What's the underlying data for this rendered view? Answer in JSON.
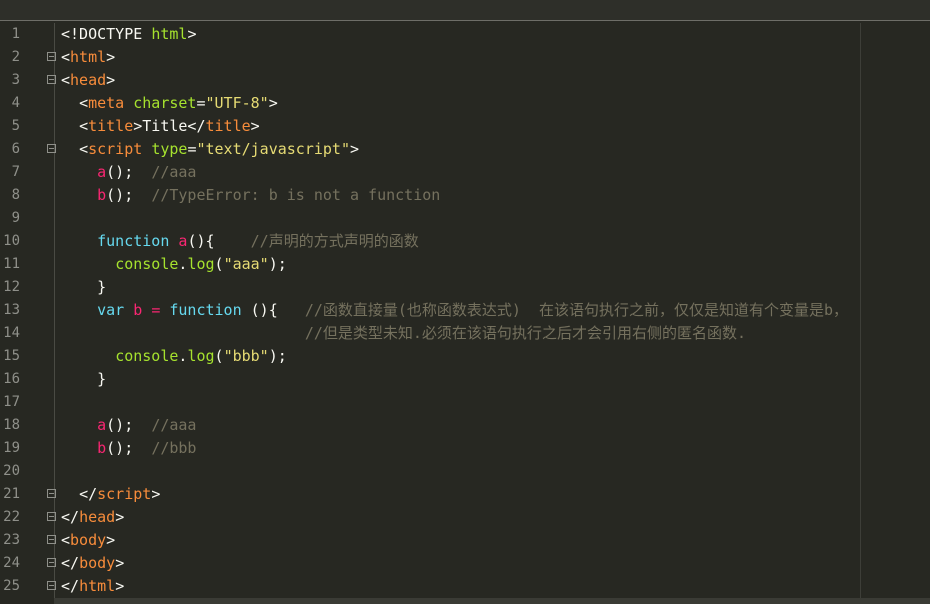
{
  "editor": {
    "lines": [
      {
        "n": "1",
        "fold": false,
        "tokens": [
          [
            "t-p",
            "<!DOCTYPE "
          ],
          [
            "t-tagname",
            "html"
          ],
          [
            "t-p",
            ">"
          ]
        ]
      },
      {
        "n": "2",
        "fold": true,
        "tokens": [
          [
            "t-p",
            "<"
          ],
          [
            "tagcolor",
            "html"
          ],
          [
            "t-p",
            ">"
          ]
        ]
      },
      {
        "n": "3",
        "fold": true,
        "tokens": [
          [
            "t-p",
            "<"
          ],
          [
            "tagcolor",
            "head"
          ],
          [
            "t-p",
            ">"
          ]
        ]
      },
      {
        "n": "4",
        "fold": false,
        "tokens": [
          [
            "ws",
            "  "
          ],
          [
            "t-p",
            "<"
          ],
          [
            "tagcolor",
            "meta "
          ],
          [
            "t-attr",
            "charset"
          ],
          [
            "t-p",
            "="
          ],
          [
            "t-str",
            "\"UTF-8\""
          ],
          [
            "t-p",
            ">"
          ]
        ]
      },
      {
        "n": "5",
        "fold": false,
        "tokens": [
          [
            "ws",
            "  "
          ],
          [
            "t-p",
            "<"
          ],
          [
            "tagcolor",
            "title"
          ],
          [
            "t-p",
            ">Title</"
          ],
          [
            "tagcolor",
            "title"
          ],
          [
            "t-p",
            ">"
          ]
        ]
      },
      {
        "n": "6",
        "fold": true,
        "tokens": [
          [
            "ws",
            "  "
          ],
          [
            "t-p",
            "<"
          ],
          [
            "tagcolor",
            "script "
          ],
          [
            "t-attr",
            "type"
          ],
          [
            "t-p",
            "="
          ],
          [
            "t-str",
            "\"text/javascript\""
          ],
          [
            "t-p",
            ">"
          ]
        ]
      },
      {
        "n": "7",
        "fold": false,
        "tokens": [
          [
            "ws",
            "    "
          ],
          [
            "t-fn",
            "a"
          ],
          [
            "t-p",
            "();"
          ],
          [
            "ws",
            "  "
          ],
          [
            "t-cm",
            "//aaa"
          ]
        ]
      },
      {
        "n": "8",
        "fold": false,
        "tokens": [
          [
            "ws",
            "    "
          ],
          [
            "t-fn",
            "b"
          ],
          [
            "t-p",
            "();"
          ],
          [
            "ws",
            "  "
          ],
          [
            "t-cm",
            "//TypeError: b is not a function"
          ]
        ]
      },
      {
        "n": "9",
        "fold": false,
        "tokens": []
      },
      {
        "n": "10",
        "fold": false,
        "tokens": [
          [
            "ws",
            "    "
          ],
          [
            "t-kw",
            "function "
          ],
          [
            "t-fn",
            "a"
          ],
          [
            "t-p",
            "(){"
          ],
          [
            "ws",
            "    "
          ],
          [
            "t-cm",
            "//声明的方式声明的函数"
          ]
        ]
      },
      {
        "n": "11",
        "fold": false,
        "tokens": [
          [
            "ws",
            "      "
          ],
          [
            "t-call",
            "console"
          ],
          [
            "t-p",
            "."
          ],
          [
            "t-call",
            "log"
          ],
          [
            "t-p",
            "("
          ],
          [
            "t-str",
            "\"aaa\""
          ],
          [
            "t-p",
            ");"
          ]
        ]
      },
      {
        "n": "12",
        "fold": false,
        "tokens": [
          [
            "ws",
            "    "
          ],
          [
            "t-p",
            "}"
          ]
        ]
      },
      {
        "n": "13",
        "fold": false,
        "tokens": [
          [
            "ws",
            "    "
          ],
          [
            "t-kw",
            "var "
          ],
          [
            "t-fn",
            "b "
          ],
          [
            "t-op",
            "= "
          ],
          [
            "t-kw",
            "function "
          ],
          [
            "t-p",
            "(){"
          ],
          [
            "ws",
            "   "
          ],
          [
            "t-cm",
            "//函数直接量(也称函数表达式)  在该语句执行之前，仅仅是知道有个变量是b，"
          ]
        ]
      },
      {
        "n": "14",
        "fold": false,
        "tokens": [
          [
            "ws",
            "                           "
          ],
          [
            "t-cm",
            "//但是类型未知.必须在该语句执行之后才会引用右侧的匿名函数."
          ]
        ]
      },
      {
        "n": "15",
        "fold": false,
        "tokens": [
          [
            "ws",
            "      "
          ],
          [
            "t-call",
            "console"
          ],
          [
            "t-p",
            "."
          ],
          [
            "t-call",
            "log"
          ],
          [
            "t-p",
            "("
          ],
          [
            "t-str",
            "\"bbb\""
          ],
          [
            "t-p",
            ");"
          ]
        ]
      },
      {
        "n": "16",
        "fold": false,
        "tokens": [
          [
            "ws",
            "    "
          ],
          [
            "t-p",
            "}"
          ]
        ]
      },
      {
        "n": "17",
        "fold": false,
        "tokens": []
      },
      {
        "n": "18",
        "fold": false,
        "tokens": [
          [
            "ws",
            "    "
          ],
          [
            "t-fn",
            "a"
          ],
          [
            "t-p",
            "();"
          ],
          [
            "ws",
            "  "
          ],
          [
            "t-cm",
            "//aaa"
          ]
        ]
      },
      {
        "n": "19",
        "fold": false,
        "tokens": [
          [
            "ws",
            "    "
          ],
          [
            "t-fn",
            "b"
          ],
          [
            "t-p",
            "();"
          ],
          [
            "ws",
            "  "
          ],
          [
            "t-cm",
            "//bbb"
          ]
        ]
      },
      {
        "n": "20",
        "fold": false,
        "tokens": []
      },
      {
        "n": "21",
        "fold": true,
        "tokens": [
          [
            "ws",
            "  "
          ],
          [
            "t-p",
            "</"
          ],
          [
            "tagcolor",
            "script"
          ],
          [
            "t-p",
            ">"
          ]
        ]
      },
      {
        "n": "22",
        "fold": true,
        "tokens": [
          [
            "t-p",
            "</"
          ],
          [
            "tagcolor",
            "head"
          ],
          [
            "t-p",
            ">"
          ]
        ]
      },
      {
        "n": "23",
        "fold": true,
        "tokens": [
          [
            "t-p",
            "<"
          ],
          [
            "tagcolor",
            "body"
          ],
          [
            "t-p",
            ">"
          ]
        ]
      },
      {
        "n": "24",
        "fold": true,
        "tokens": [
          [
            "t-p",
            "</"
          ],
          [
            "tagcolor",
            "body"
          ],
          [
            "t-p",
            ">"
          ]
        ]
      },
      {
        "n": "25",
        "fold": true,
        "tokens": [
          [
            "t-p",
            "</"
          ],
          [
            "tagcolor",
            "html"
          ],
          [
            "t-p",
            ">"
          ]
        ]
      }
    ]
  }
}
